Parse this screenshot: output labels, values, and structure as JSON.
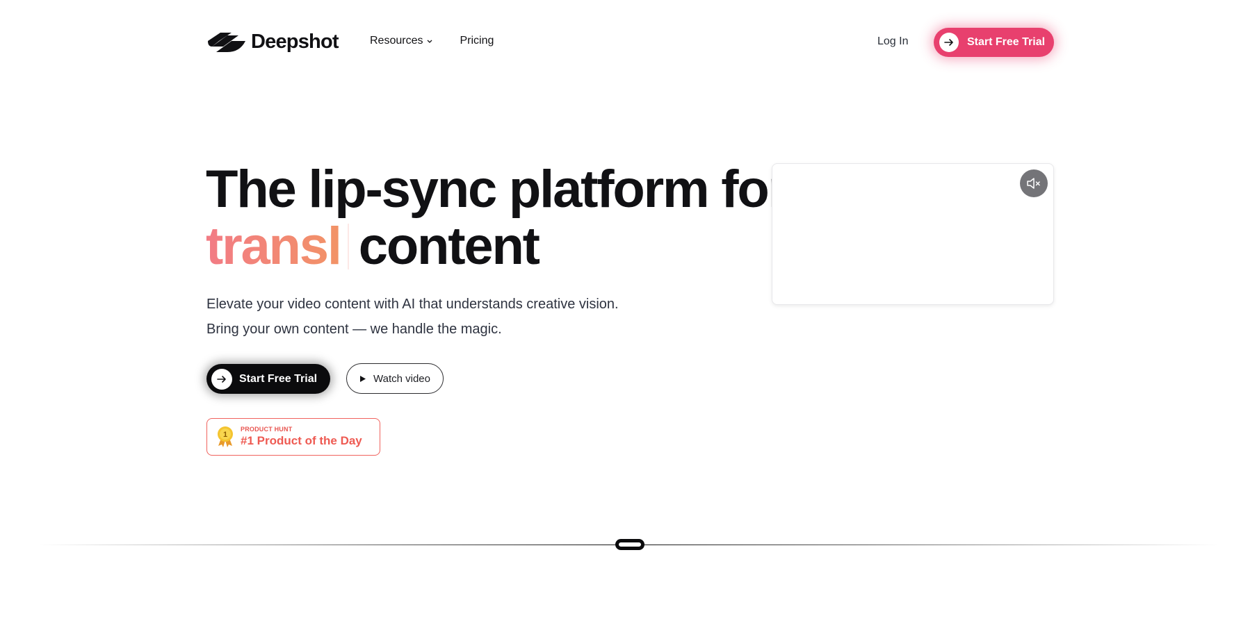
{
  "header": {
    "logo_text": "Deepshot",
    "nav": [
      {
        "label": "Resources",
        "has_dropdown": true,
        "icon": "chevron-down-icon"
      },
      {
        "label": "Pricing",
        "has_dropdown": false
      }
    ],
    "login_label": "Log In",
    "cta_label": "Start Free Trial",
    "cta_icon": "arrow-right-icon",
    "cta_color": "#e8406e"
  },
  "hero": {
    "title_line1": "The lip-sync platform for",
    "title_typed": "transl",
    "title_line2_rest": "content",
    "subtitle_line1": "Elevate your video content with AI that understands creative vision.",
    "subtitle_line2": "Bring your own content — we handle the magic.",
    "primary_button": {
      "label": "Start Free Trial",
      "icon": "arrow-right-icon"
    },
    "secondary_button": {
      "label": "Watch video",
      "icon": "play-icon"
    },
    "badge": {
      "eyebrow": "PRODUCT HUNT",
      "title": "#1 Product of the Day",
      "medal_number": "1",
      "icon": "medal-icon",
      "color": "#ee5a52"
    }
  },
  "video": {
    "mute_icon": "volume-muted-icon"
  },
  "colors": {
    "accent_pink": "#e8406e",
    "gradient_start": "#f27b85",
    "gradient_end": "#f29366",
    "text_dark": "#111114"
  }
}
